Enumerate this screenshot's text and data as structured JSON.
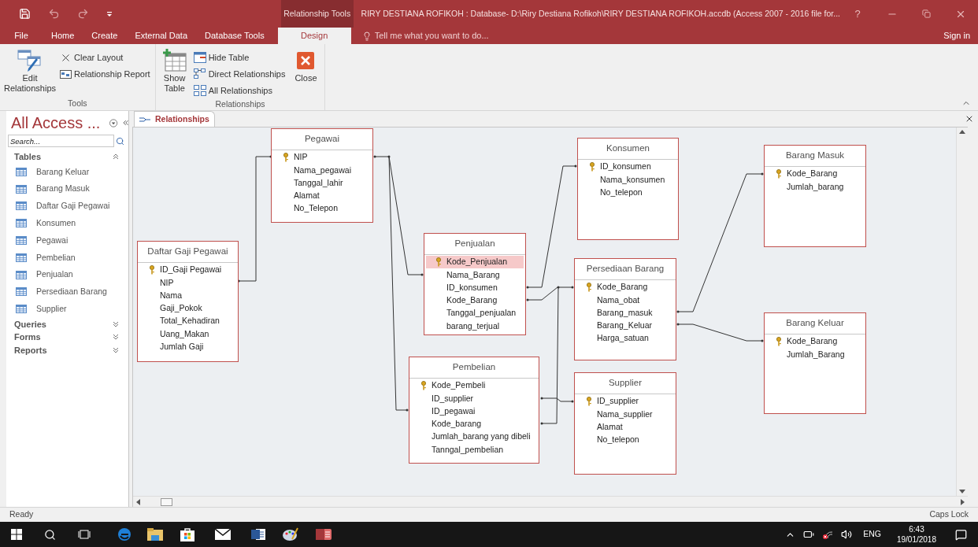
{
  "title_bar": {
    "contextual_label": "Relationship Tools",
    "title": "RIRY DESTIANA ROFIKOH : Database- D:\\Riry Destiana Rofikoh\\RIRY DESTIANA ROFIKOH.accdb (Access 2007 - 2016 file for...",
    "help": "?"
  },
  "menu_tabs": [
    {
      "label": "File",
      "selected": false
    },
    {
      "label": "Home",
      "selected": false
    },
    {
      "label": "Create",
      "selected": false
    },
    {
      "label": "External Data",
      "selected": false
    },
    {
      "label": "Database Tools",
      "selected": false
    },
    {
      "label": "Design",
      "selected": true
    }
  ],
  "tell_me": {
    "label": "Tell me what you want to do..."
  },
  "sign_in": "Sign in",
  "ribbon": {
    "groups": [
      {
        "label": "Tools",
        "items": [
          {
            "label": "Edit Relationships",
            "kind": "large"
          },
          {
            "label": "Clear Layout",
            "kind": "small"
          },
          {
            "label": "Relationship Report",
            "kind": "small"
          }
        ]
      },
      {
        "label": "Relationships",
        "items": [
          {
            "label": "Show Table",
            "kind": "large"
          },
          {
            "label": "Hide Table",
            "kind": "small"
          },
          {
            "label": "Direct Relationships",
            "kind": "small"
          },
          {
            "label": "All Relationships",
            "kind": "small"
          },
          {
            "label": "Close",
            "kind": "large"
          }
        ]
      }
    ]
  },
  "navigation": {
    "title": "All Access ...",
    "search": {
      "placeholder": "Search..."
    },
    "groups": [
      {
        "label": "Tables",
        "expanded": true,
        "items": [
          "Barang Keluar",
          "Barang Masuk",
          "Daftar Gaji Pegawai",
          "Konsumen",
          "Pegawai",
          "Pembelian",
          "Penjualan",
          "Persediaan Barang",
          "Supplier"
        ]
      },
      {
        "label": "Queries",
        "expanded": false
      },
      {
        "label": "Forms",
        "expanded": false
      },
      {
        "label": "Reports",
        "expanded": false
      }
    ]
  },
  "document_tab": {
    "label": "Relationships"
  },
  "tables": [
    {
      "name": "Pegawai",
      "fields": [
        {
          "name": "NIP",
          "primary_key": true,
          "selected": false
        },
        {
          "name": "Nama_pegawai",
          "primary_key": false,
          "selected": false
        },
        {
          "name": "Tanggal_lahir",
          "primary_key": false,
          "selected": false
        },
        {
          "name": "Alamat",
          "primary_key": false,
          "selected": false
        },
        {
          "name": "No_Telepon",
          "primary_key": false,
          "selected": false
        }
      ]
    },
    {
      "name": "Daftar Gaji Pegawai",
      "fields": [
        {
          "name": "ID_Gaji Pegawai",
          "primary_key": true,
          "selected": false
        },
        {
          "name": "NIP",
          "primary_key": false,
          "selected": false
        },
        {
          "name": "Nama",
          "primary_key": false,
          "selected": false
        },
        {
          "name": "Gaji_Pokok",
          "primary_key": false,
          "selected": false
        },
        {
          "name": "Total_Kehadiran",
          "primary_key": false,
          "selected": false
        },
        {
          "name": "Uang_Makan",
          "primary_key": false,
          "selected": false
        },
        {
          "name": "Jumlah Gaji",
          "primary_key": false,
          "selected": false
        }
      ]
    },
    {
      "name": "Konsumen",
      "fields": [
        {
          "name": "ID_konsumen",
          "primary_key": true,
          "selected": false
        },
        {
          "name": "Nama_konsumen",
          "primary_key": false,
          "selected": false
        },
        {
          "name": "No_telepon",
          "primary_key": false,
          "selected": false
        }
      ]
    },
    {
      "name": "Barang Masuk",
      "fields": [
        {
          "name": "Kode_Barang",
          "primary_key": true,
          "selected": false
        },
        {
          "name": "Jumlah_barang",
          "primary_key": false,
          "selected": false
        }
      ]
    },
    {
      "name": "Penjualan",
      "fields": [
        {
          "name": "Kode_Penjualan",
          "primary_key": true,
          "selected": true
        },
        {
          "name": "Nama_Barang",
          "primary_key": false,
          "selected": false
        },
        {
          "name": "ID_konsumen",
          "primary_key": false,
          "selected": false
        },
        {
          "name": "Kode_Barang",
          "primary_key": false,
          "selected": false
        },
        {
          "name": "Tanggal_penjualan",
          "primary_key": false,
          "selected": false
        },
        {
          "name": "barang_terjual",
          "primary_key": false,
          "selected": false
        }
      ]
    },
    {
      "name": "Persediaan Barang",
      "fields": [
        {
          "name": "Kode_Barang",
          "primary_key": true,
          "selected": false
        },
        {
          "name": "Nama_obat",
          "primary_key": false,
          "selected": false
        },
        {
          "name": "Barang_masuk",
          "primary_key": false,
          "selected": false
        },
        {
          "name": "Barang_Keluar",
          "primary_key": false,
          "selected": false
        },
        {
          "name": "Harga_satuan",
          "primary_key": false,
          "selected": false
        }
      ]
    },
    {
      "name": "Barang Keluar",
      "fields": [
        {
          "name": "Kode_Barang",
          "primary_key": true,
          "selected": false
        },
        {
          "name": "Jumlah_Barang",
          "primary_key": false,
          "selected": false
        }
      ]
    },
    {
      "name": "Pembelian",
      "fields": [
        {
          "name": "Kode_Pembeli",
          "primary_key": true,
          "selected": false
        },
        {
          "name": "ID_supplier",
          "primary_key": false,
          "selected": false
        },
        {
          "name": "ID_pegawai",
          "primary_key": false,
          "selected": false
        },
        {
          "name": "Kode_barang",
          "primary_key": false,
          "selected": false
        },
        {
          "name": "Jumlah_barang yang dibeli",
          "primary_key": false,
          "selected": false
        },
        {
          "name": "Tanngal_pembelian",
          "primary_key": false,
          "selected": false
        }
      ]
    },
    {
      "name": "Supplier",
      "fields": [
        {
          "name": "ID_supplier",
          "primary_key": true,
          "selected": false
        },
        {
          "name": "Nama_supplier",
          "primary_key": false,
          "selected": false
        },
        {
          "name": "Alamat",
          "primary_key": false,
          "selected": false
        },
        {
          "name": "No_telepon",
          "primary_key": false,
          "selected": false
        }
      ]
    }
  ],
  "status_bar": {
    "left": "Ready",
    "right": "Caps Lock"
  },
  "taskbar": {
    "language": "ENG",
    "time": "6:43",
    "date": "19/01/2018"
  }
}
